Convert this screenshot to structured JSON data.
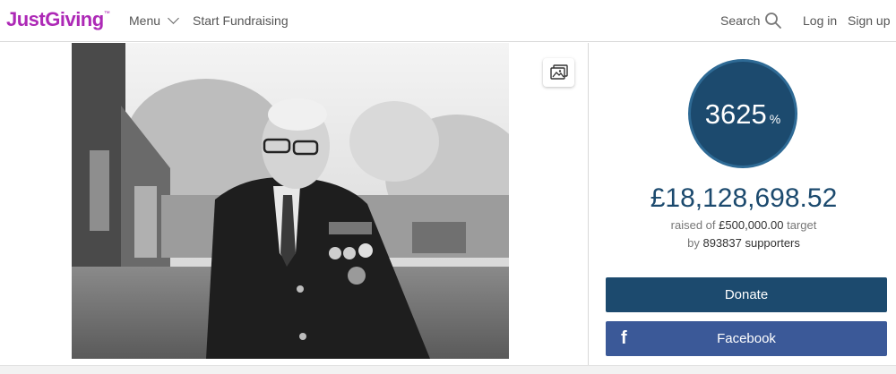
{
  "header": {
    "logo": "JustGiving",
    "logo_tm": "™",
    "menu_label": "Menu",
    "start_fundraising": "Start Fundraising",
    "search_label": "Search",
    "login": "Log in",
    "signup": "Sign up",
    "icons": [
      "chevron-down-icon",
      "search-icon"
    ]
  },
  "media": {
    "image_alt": "Captain Tom photograph",
    "gallery_icon": "gallery-icon"
  },
  "progress": {
    "percent": "3625",
    "percent_sign": "%",
    "raised": "£18,128,698.52",
    "raised_prefix": "raised of",
    "target": "£500,000.00",
    "target_suffix": "target",
    "supporters_prefix": "by",
    "supporters": "893837 supporters"
  },
  "actions": {
    "donate": "Donate",
    "facebook": "Facebook",
    "facebook_icon": "f"
  },
  "colors": {
    "brand": "#ad29b6",
    "primary": "#1c4a6e",
    "facebook": "#3b5998"
  }
}
